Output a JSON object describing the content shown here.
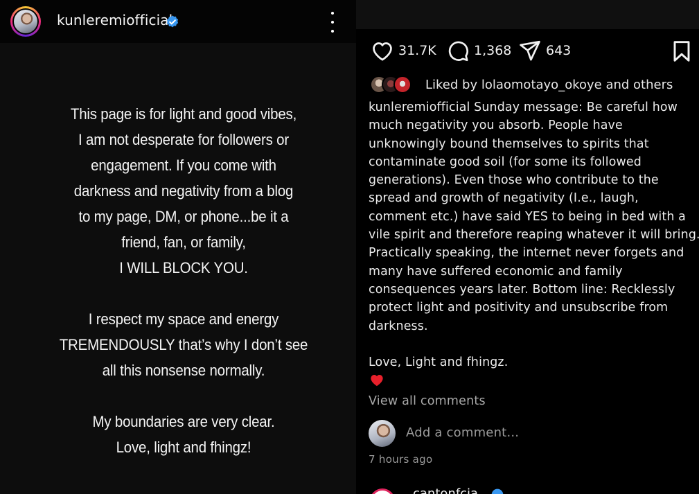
{
  "story_panel": {
    "username": "kunleremiofficial",
    "verified": true,
    "more_icon": "more-vertical-icon",
    "text_paragraphs": [
      [
        "This page is for light and good vibes,",
        "I am not desperate for followers or",
        "engagement. If you come with",
        "darkness and negativity from a blog",
        "to my page, DM, or phone...be it a",
        "friend, fan, or family,",
        "I WILL BLOCK YOU."
      ],
      [
        "I respect my space and energy",
        "TREMENDOUSLY that’s why I don’t see",
        "all this nonsense normally."
      ],
      [
        "My boundaries are very clear.",
        "Love, light and fhingz!"
      ]
    ]
  },
  "post_panel": {
    "actions": {
      "like": {
        "icon": "heart-icon",
        "count": "31.7K"
      },
      "comment": {
        "icon": "comment-bubble-icon",
        "count": "1,368"
      },
      "share": {
        "icon": "send-icon",
        "count": "643"
      },
      "save": {
        "icon": "bookmark-icon"
      }
    },
    "liked_by": "Liked by lolaomotayo_okoye and others",
    "caption_lines": [
      "kunleremiofficial Sunday message: Be careful how",
      "much negativity you absorb. People have",
      "unknowingly bound themselves to spirits that",
      "contaminate good soil (for some its followed",
      "generations). Even those who contribute to the",
      "spread and growth of negativity (I.e., laugh,",
      "comment etc.) have said YES to being in bed with a",
      "vile spirit and therefore reaping whatever it will bring.",
      "Practically speaking, the internet never forgets and",
      "many have suffered economic and family",
      "consequences years later. Bottom line: Recklessly",
      "protect light and positivity and unsubscribe from",
      "darkness."
    ],
    "caption_signoff": "Love, Light and fhingz.",
    "caption_emoji": "red-heart-emoji",
    "view_all_comments": "View all comments",
    "add_comment_placeholder": "Add a comment...",
    "timestamp": "7 hours ago",
    "next_post_username": "cantonfcia"
  },
  "colors": {
    "verified_blue": "#3897f0",
    "heart_red": "#e8202b",
    "muted_text": "#a8a8a8"
  }
}
